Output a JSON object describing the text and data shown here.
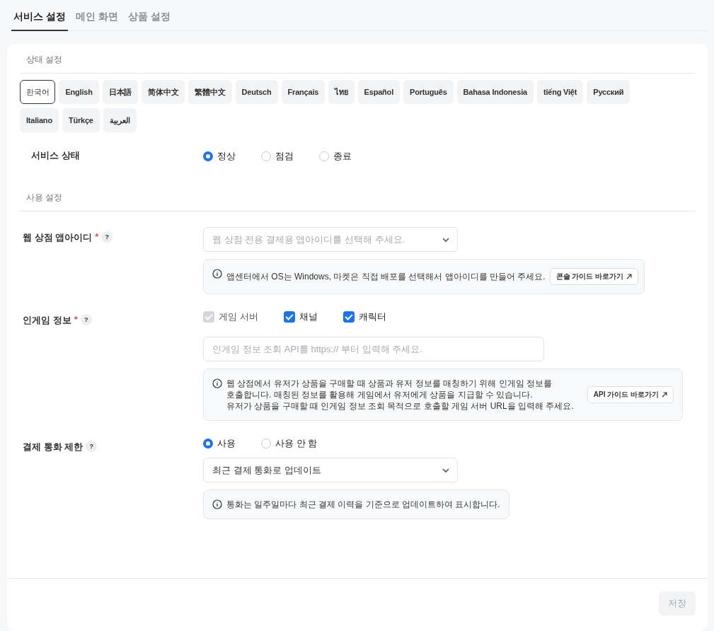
{
  "tabs": [
    {
      "label": "서비스 설정",
      "selected": true
    },
    {
      "label": "메인 화면",
      "selected": false
    },
    {
      "label": "상품 설정",
      "selected": false
    }
  ],
  "status_section": {
    "title": "상태 설정",
    "languages": [
      {
        "label": "한국어",
        "selected": true
      },
      {
        "label": "English",
        "selected": false
      },
      {
        "label": "日本語",
        "selected": false
      },
      {
        "label": "简体中文",
        "selected": false
      },
      {
        "label": "繁體中文",
        "selected": false
      },
      {
        "label": "Deutsch",
        "selected": false
      },
      {
        "label": "Français",
        "selected": false
      },
      {
        "label": "ไทย",
        "selected": false
      },
      {
        "label": "Español",
        "selected": false
      },
      {
        "label": "Português",
        "selected": false
      },
      {
        "label": "Bahasa Indonesia",
        "selected": false
      },
      {
        "label": "tiếng Việt",
        "selected": false
      },
      {
        "label": "Русский",
        "selected": false
      },
      {
        "label": "Italiano",
        "selected": false
      },
      {
        "label": "Türkçe",
        "selected": false
      },
      {
        "label": "العربية",
        "selected": false
      }
    ],
    "service_status": {
      "label": "서비스 상태",
      "options": [
        {
          "label": "정상",
          "selected": true
        },
        {
          "label": "점검",
          "selected": false
        },
        {
          "label": "종료",
          "selected": false
        }
      ]
    }
  },
  "usage_section": {
    "title": "사용 설정",
    "app_id": {
      "label": "웹 상점 앱아이디",
      "required": "*",
      "help": "?",
      "select": {
        "placeholder": "웹 상점 전용 결제용 앱아이디를 선택해 주세요."
      },
      "info": {
        "lines": [
          "앱센터에서 OS는 Windows, 마켓은 직접 배포를 선택해서 앱아이디를 만들어 주세요."
        ],
        "link": "콘솔 가이드 바로가기"
      }
    },
    "ingame_info": {
      "label": "인게임 정보",
      "required": "*",
      "help": "?",
      "checkboxes": [
        {
          "label": "게임 서버",
          "checked": true,
          "disabled": true
        },
        {
          "label": "채널",
          "checked": true,
          "disabled": false
        },
        {
          "label": "캐릭터",
          "checked": true,
          "disabled": false
        }
      ],
      "input": {
        "placeholder": "인게임 정보 조회 API를 https:// 부터 입력해 주세요."
      },
      "info": {
        "lines": [
          "웹 상점에서 유저가 상품을 구매할 때 상품과 유저 정보를 매칭하기 위해 인게임 정보를",
          "호출합니다. 매칭된 정보를 활용해 게임에서 유저에게 상품을 지급할 수 있습니다.",
          "유저가 상품을 구매할 때 인게임 정보 조회 목적으로 호출할 게임 서버 URL을 입력해 주세요."
        ],
        "link": "API 가이드 바로가기"
      }
    },
    "currency_limit": {
      "label": "결제 통화 제한",
      "help": "?",
      "options": [
        {
          "label": "사용",
          "selected": true
        },
        {
          "label": "사용 안 함",
          "selected": false
        }
      ],
      "select": {
        "value": "최근 결제 통화로 업데이트"
      },
      "info": {
        "lines": [
          "통화는 일주일마다 최근 결제 이력을 기준으로 업데이트하여 표시합니다."
        ]
      }
    }
  },
  "footer": {
    "save_button": {
      "label": "저장",
      "disabled": true
    }
  }
}
